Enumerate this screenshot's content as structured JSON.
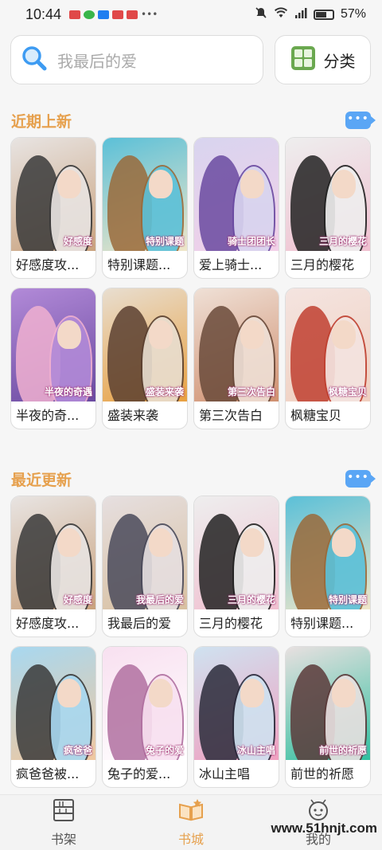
{
  "status": {
    "time": "10:44",
    "battery": "57%",
    "network": "4G"
  },
  "search": {
    "placeholder": "我最后的爱"
  },
  "category": {
    "label": "分类"
  },
  "sections": [
    {
      "title": "近期上新",
      "more": "•••",
      "items": [
        {
          "title": "好感度攻...",
          "cover_tag": "好感度",
          "colors": [
            "#e8e4e2",
            "#3a3a3a",
            "#c9a27e"
          ]
        },
        {
          "title": "特别课题...",
          "cover_tag": "特别课题",
          "colors": [
            "#5bc0d8",
            "#9a6a3a",
            "#f0e6c8"
          ]
        },
        {
          "title": "爱上骑士...",
          "cover_tag": "骑士团团长",
          "colors": [
            "#d8d4ef",
            "#6a4aa0",
            "#f2d0e8"
          ]
        },
        {
          "title": "三月的樱花",
          "cover_tag": "三月的樱花",
          "colors": [
            "#eeeeee",
            "#222222",
            "#f0c0d0"
          ]
        },
        {
          "title": "半夜的奇...",
          "cover_tag": "半夜的奇遇",
          "colors": [
            "#b28ad8",
            "#f0b0d0",
            "#6a4aa0"
          ]
        },
        {
          "title": "盛装来袭",
          "cover_tag": "盛装来袭",
          "colors": [
            "#e8ded0",
            "#5a4030",
            "#e8a040"
          ]
        },
        {
          "title": "第三次告白",
          "cover_tag": "第三次告白",
          "colors": [
            "#efe0d6",
            "#6a4a3a",
            "#d09070"
          ]
        },
        {
          "title": "枫糖宝贝",
          "cover_tag": "枫糖宝贝",
          "colors": [
            "#f4e4e0",
            "#c04030",
            "#f0d0c0"
          ]
        }
      ]
    },
    {
      "title": "最近更新",
      "more": "•••",
      "items": [
        {
          "title": "好感度攻...",
          "cover_tag": "好感度",
          "colors": [
            "#e8e4e2",
            "#3a3a3a",
            "#c9a27e"
          ]
        },
        {
          "title": "我最后的爱",
          "cover_tag": "我最后的爱",
          "colors": [
            "#e6dfe0",
            "#4a4a5a",
            "#d8c0a0"
          ]
        },
        {
          "title": "三月的樱花",
          "cover_tag": "三月的樱花",
          "colors": [
            "#eeeeee",
            "#222222",
            "#f0c0d0"
          ]
        },
        {
          "title": "特别课题...",
          "cover_tag": "特别课题",
          "colors": [
            "#5bc0d8",
            "#9a6a3a",
            "#f0e6c8"
          ]
        },
        {
          "title": "疯爸爸被...",
          "cover_tag": "疯爸爸",
          "colors": [
            "#a8d8f0",
            "#3a3a3a",
            "#f0c8a0"
          ]
        },
        {
          "title": "兔子的爱...",
          "cover_tag": "兔子的爱",
          "colors": [
            "#f8e0f0",
            "#b070a0",
            "#ffffff"
          ]
        },
        {
          "title": "冰山主唱",
          "cover_tag": "冰山主唱",
          "colors": [
            "#cfe2f0",
            "#2a2a3a",
            "#f0a0c0"
          ]
        },
        {
          "title": "前世的祈愿",
          "cover_tag": "前世的祈愿",
          "colors": [
            "#e8e0e0",
            "#5a3a3a",
            "#30c0a0"
          ]
        }
      ]
    }
  ],
  "tabs": [
    {
      "label": "书架",
      "icon": "bookshelf-icon",
      "active": false
    },
    {
      "label": "书城",
      "icon": "bookstore-icon",
      "active": true
    },
    {
      "label": "我的",
      "icon": "profile-icon",
      "active": false
    }
  ],
  "watermark": "www.51hnjt.com",
  "colors": {
    "accent": "#e6a04d",
    "more_button": "#5aa6f5",
    "search_icon": "#3d9bf2",
    "category_icon": "#6aa84f"
  }
}
